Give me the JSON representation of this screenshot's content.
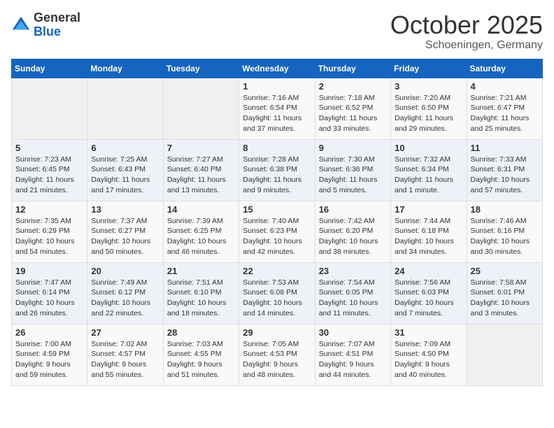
{
  "logo": {
    "general": "General",
    "blue": "Blue"
  },
  "header": {
    "month": "October 2025",
    "location": "Schoeningen, Germany"
  },
  "days_of_week": [
    "Sunday",
    "Monday",
    "Tuesday",
    "Wednesday",
    "Thursday",
    "Friday",
    "Saturday"
  ],
  "weeks": [
    [
      {
        "day": "",
        "info": ""
      },
      {
        "day": "",
        "info": ""
      },
      {
        "day": "",
        "info": ""
      },
      {
        "day": "1",
        "info": "Sunrise: 7:16 AM\nSunset: 6:54 PM\nDaylight: 11 hours\nand 37 minutes."
      },
      {
        "day": "2",
        "info": "Sunrise: 7:18 AM\nSunset: 6:52 PM\nDaylight: 11 hours\nand 33 minutes."
      },
      {
        "day": "3",
        "info": "Sunrise: 7:20 AM\nSunset: 6:50 PM\nDaylight: 11 hours\nand 29 minutes."
      },
      {
        "day": "4",
        "info": "Sunrise: 7:21 AM\nSunset: 6:47 PM\nDaylight: 11 hours\nand 25 minutes."
      }
    ],
    [
      {
        "day": "5",
        "info": "Sunrise: 7:23 AM\nSunset: 6:45 PM\nDaylight: 11 hours\nand 21 minutes."
      },
      {
        "day": "6",
        "info": "Sunrise: 7:25 AM\nSunset: 6:43 PM\nDaylight: 11 hours\nand 17 minutes."
      },
      {
        "day": "7",
        "info": "Sunrise: 7:27 AM\nSunset: 6:40 PM\nDaylight: 11 hours\nand 13 minutes."
      },
      {
        "day": "8",
        "info": "Sunrise: 7:28 AM\nSunset: 6:38 PM\nDaylight: 11 hours\nand 9 minutes."
      },
      {
        "day": "9",
        "info": "Sunrise: 7:30 AM\nSunset: 6:36 PM\nDaylight: 11 hours\nand 5 minutes."
      },
      {
        "day": "10",
        "info": "Sunrise: 7:32 AM\nSunset: 6:34 PM\nDaylight: 11 hours\nand 1 minute."
      },
      {
        "day": "11",
        "info": "Sunrise: 7:33 AM\nSunset: 6:31 PM\nDaylight: 10 hours\nand 57 minutes."
      }
    ],
    [
      {
        "day": "12",
        "info": "Sunrise: 7:35 AM\nSunset: 6:29 PM\nDaylight: 10 hours\nand 54 minutes."
      },
      {
        "day": "13",
        "info": "Sunrise: 7:37 AM\nSunset: 6:27 PM\nDaylight: 10 hours\nand 50 minutes."
      },
      {
        "day": "14",
        "info": "Sunrise: 7:39 AM\nSunset: 6:25 PM\nDaylight: 10 hours\nand 46 minutes."
      },
      {
        "day": "15",
        "info": "Sunrise: 7:40 AM\nSunset: 6:23 PM\nDaylight: 10 hours\nand 42 minutes."
      },
      {
        "day": "16",
        "info": "Sunrise: 7:42 AM\nSunset: 6:20 PM\nDaylight: 10 hours\nand 38 minutes."
      },
      {
        "day": "17",
        "info": "Sunrise: 7:44 AM\nSunset: 6:18 PM\nDaylight: 10 hours\nand 34 minutes."
      },
      {
        "day": "18",
        "info": "Sunrise: 7:46 AM\nSunset: 6:16 PM\nDaylight: 10 hours\nand 30 minutes."
      }
    ],
    [
      {
        "day": "19",
        "info": "Sunrise: 7:47 AM\nSunset: 6:14 PM\nDaylight: 10 hours\nand 26 minutes."
      },
      {
        "day": "20",
        "info": "Sunrise: 7:49 AM\nSunset: 6:12 PM\nDaylight: 10 hours\nand 22 minutes."
      },
      {
        "day": "21",
        "info": "Sunrise: 7:51 AM\nSunset: 6:10 PM\nDaylight: 10 hours\nand 18 minutes."
      },
      {
        "day": "22",
        "info": "Sunrise: 7:53 AM\nSunset: 6:08 PM\nDaylight: 10 hours\nand 14 minutes."
      },
      {
        "day": "23",
        "info": "Sunrise: 7:54 AM\nSunset: 6:05 PM\nDaylight: 10 hours\nand 11 minutes."
      },
      {
        "day": "24",
        "info": "Sunrise: 7:56 AM\nSunset: 6:03 PM\nDaylight: 10 hours\nand 7 minutes."
      },
      {
        "day": "25",
        "info": "Sunrise: 7:58 AM\nSunset: 6:01 PM\nDaylight: 10 hours\nand 3 minutes."
      }
    ],
    [
      {
        "day": "26",
        "info": "Sunrise: 7:00 AM\nSunset: 4:59 PM\nDaylight: 9 hours\nand 59 minutes."
      },
      {
        "day": "27",
        "info": "Sunrise: 7:02 AM\nSunset: 4:57 PM\nDaylight: 9 hours\nand 55 minutes."
      },
      {
        "day": "28",
        "info": "Sunrise: 7:03 AM\nSunset: 4:55 PM\nDaylight: 9 hours\nand 51 minutes."
      },
      {
        "day": "29",
        "info": "Sunrise: 7:05 AM\nSunset: 4:53 PM\nDaylight: 9 hours\nand 48 minutes."
      },
      {
        "day": "30",
        "info": "Sunrise: 7:07 AM\nSunset: 4:51 PM\nDaylight: 9 hours\nand 44 minutes."
      },
      {
        "day": "31",
        "info": "Sunrise: 7:09 AM\nSunset: 4:50 PM\nDaylight: 9 hours\nand 40 minutes."
      },
      {
        "day": "",
        "info": ""
      }
    ]
  ]
}
